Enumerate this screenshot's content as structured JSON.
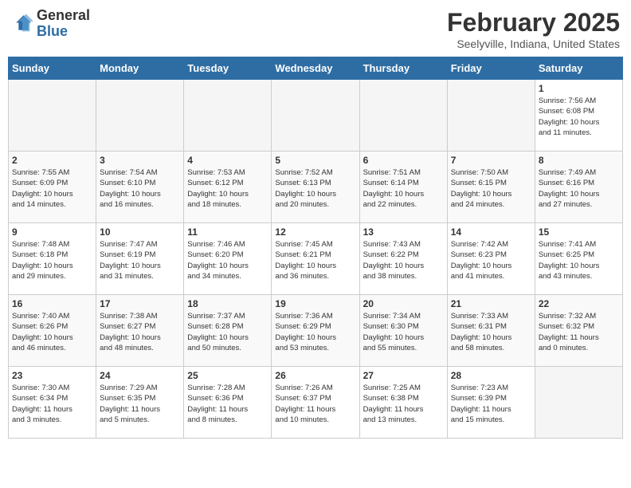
{
  "header": {
    "logo_general": "General",
    "logo_blue": "Blue",
    "title": "February 2025",
    "location": "Seelyville, Indiana, United States"
  },
  "days_of_week": [
    "Sunday",
    "Monday",
    "Tuesday",
    "Wednesday",
    "Thursday",
    "Friday",
    "Saturday"
  ],
  "weeks": [
    [
      {
        "day": "",
        "info": ""
      },
      {
        "day": "",
        "info": ""
      },
      {
        "day": "",
        "info": ""
      },
      {
        "day": "",
        "info": ""
      },
      {
        "day": "",
        "info": ""
      },
      {
        "day": "",
        "info": ""
      },
      {
        "day": "1",
        "info": "Sunrise: 7:56 AM\nSunset: 6:08 PM\nDaylight: 10 hours\nand 11 minutes."
      }
    ],
    [
      {
        "day": "2",
        "info": "Sunrise: 7:55 AM\nSunset: 6:09 PM\nDaylight: 10 hours\nand 14 minutes."
      },
      {
        "day": "3",
        "info": "Sunrise: 7:54 AM\nSunset: 6:10 PM\nDaylight: 10 hours\nand 16 minutes."
      },
      {
        "day": "4",
        "info": "Sunrise: 7:53 AM\nSunset: 6:12 PM\nDaylight: 10 hours\nand 18 minutes."
      },
      {
        "day": "5",
        "info": "Sunrise: 7:52 AM\nSunset: 6:13 PM\nDaylight: 10 hours\nand 20 minutes."
      },
      {
        "day": "6",
        "info": "Sunrise: 7:51 AM\nSunset: 6:14 PM\nDaylight: 10 hours\nand 22 minutes."
      },
      {
        "day": "7",
        "info": "Sunrise: 7:50 AM\nSunset: 6:15 PM\nDaylight: 10 hours\nand 24 minutes."
      },
      {
        "day": "8",
        "info": "Sunrise: 7:49 AM\nSunset: 6:16 PM\nDaylight: 10 hours\nand 27 minutes."
      }
    ],
    [
      {
        "day": "9",
        "info": "Sunrise: 7:48 AM\nSunset: 6:18 PM\nDaylight: 10 hours\nand 29 minutes."
      },
      {
        "day": "10",
        "info": "Sunrise: 7:47 AM\nSunset: 6:19 PM\nDaylight: 10 hours\nand 31 minutes."
      },
      {
        "day": "11",
        "info": "Sunrise: 7:46 AM\nSunset: 6:20 PM\nDaylight: 10 hours\nand 34 minutes."
      },
      {
        "day": "12",
        "info": "Sunrise: 7:45 AM\nSunset: 6:21 PM\nDaylight: 10 hours\nand 36 minutes."
      },
      {
        "day": "13",
        "info": "Sunrise: 7:43 AM\nSunset: 6:22 PM\nDaylight: 10 hours\nand 38 minutes."
      },
      {
        "day": "14",
        "info": "Sunrise: 7:42 AM\nSunset: 6:23 PM\nDaylight: 10 hours\nand 41 minutes."
      },
      {
        "day": "15",
        "info": "Sunrise: 7:41 AM\nSunset: 6:25 PM\nDaylight: 10 hours\nand 43 minutes."
      }
    ],
    [
      {
        "day": "16",
        "info": "Sunrise: 7:40 AM\nSunset: 6:26 PM\nDaylight: 10 hours\nand 46 minutes."
      },
      {
        "day": "17",
        "info": "Sunrise: 7:38 AM\nSunset: 6:27 PM\nDaylight: 10 hours\nand 48 minutes."
      },
      {
        "day": "18",
        "info": "Sunrise: 7:37 AM\nSunset: 6:28 PM\nDaylight: 10 hours\nand 50 minutes."
      },
      {
        "day": "19",
        "info": "Sunrise: 7:36 AM\nSunset: 6:29 PM\nDaylight: 10 hours\nand 53 minutes."
      },
      {
        "day": "20",
        "info": "Sunrise: 7:34 AM\nSunset: 6:30 PM\nDaylight: 10 hours\nand 55 minutes."
      },
      {
        "day": "21",
        "info": "Sunrise: 7:33 AM\nSunset: 6:31 PM\nDaylight: 10 hours\nand 58 minutes."
      },
      {
        "day": "22",
        "info": "Sunrise: 7:32 AM\nSunset: 6:32 PM\nDaylight: 11 hours\nand 0 minutes."
      }
    ],
    [
      {
        "day": "23",
        "info": "Sunrise: 7:30 AM\nSunset: 6:34 PM\nDaylight: 11 hours\nand 3 minutes."
      },
      {
        "day": "24",
        "info": "Sunrise: 7:29 AM\nSunset: 6:35 PM\nDaylight: 11 hours\nand 5 minutes."
      },
      {
        "day": "25",
        "info": "Sunrise: 7:28 AM\nSunset: 6:36 PM\nDaylight: 11 hours\nand 8 minutes."
      },
      {
        "day": "26",
        "info": "Sunrise: 7:26 AM\nSunset: 6:37 PM\nDaylight: 11 hours\nand 10 minutes."
      },
      {
        "day": "27",
        "info": "Sunrise: 7:25 AM\nSunset: 6:38 PM\nDaylight: 11 hours\nand 13 minutes."
      },
      {
        "day": "28",
        "info": "Sunrise: 7:23 AM\nSunset: 6:39 PM\nDaylight: 11 hours\nand 15 minutes."
      },
      {
        "day": "",
        "info": ""
      }
    ]
  ]
}
